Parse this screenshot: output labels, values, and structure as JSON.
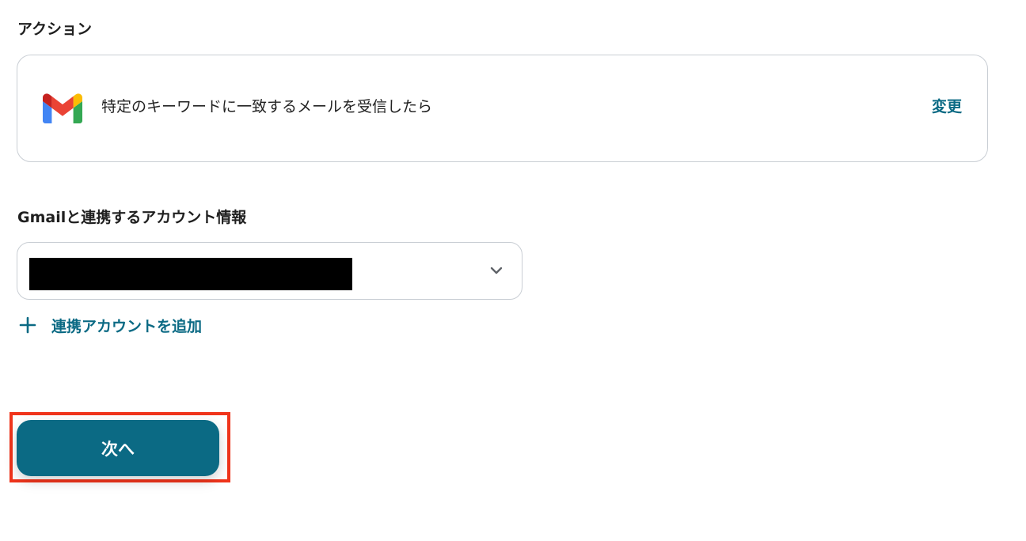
{
  "action_section": {
    "label": "アクション",
    "card": {
      "icon": "gmail-icon",
      "text": "特定のキーワードに一致するメールを受信したら",
      "change_label": "変更"
    }
  },
  "account_section": {
    "label": "Gmailと連携するアカウント情報",
    "select": {
      "value_redacted": true,
      "icon": "chevron-down-icon"
    },
    "add_account_label": "連携アカウントを追加",
    "add_icon": "plus-icon"
  },
  "footer": {
    "next_label": "次へ"
  },
  "colors": {
    "accent": "#0b6a84",
    "border": "#c9ced4",
    "highlight": "#f0341b",
    "text": "#1f1f1f"
  }
}
